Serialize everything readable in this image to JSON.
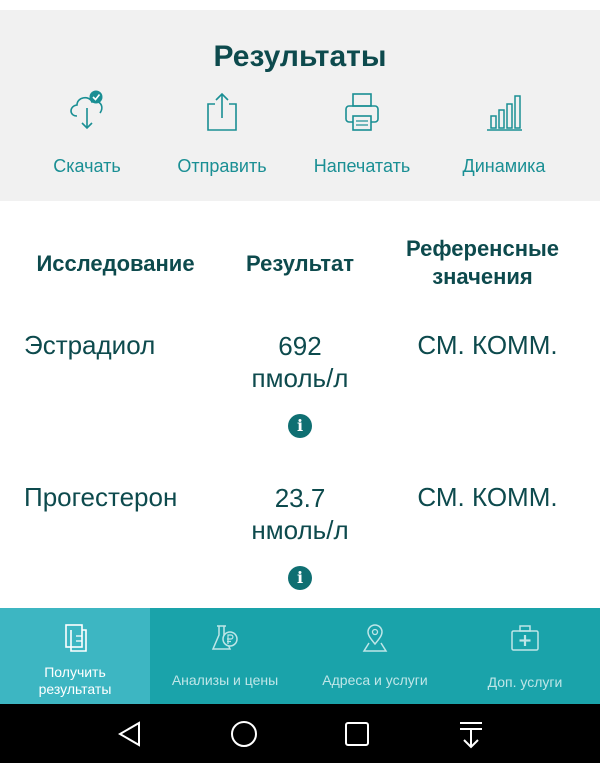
{
  "header": {
    "title": "Результаты",
    "actions": [
      {
        "label": "Скачать",
        "icon": "cloud-download-icon"
      },
      {
        "label": "Отправить",
        "icon": "share-icon"
      },
      {
        "label": "Напечатать",
        "icon": "printer-icon"
      },
      {
        "label": "Динамика",
        "icon": "bar-chart-icon"
      }
    ]
  },
  "table": {
    "headers": {
      "study": "Исследование",
      "result": "Результат",
      "reference_line1": "Референсные",
      "reference_line2": "значения"
    },
    "rows": [
      {
        "name": "Эстрадиол",
        "value": "692",
        "unit": "пмоль/л",
        "reference": "СМ. КОММ.",
        "info": "i"
      },
      {
        "name": "Прогестерон",
        "value": "23.7",
        "unit": "нмоль/л",
        "reference": "СМ. КОММ.",
        "info": "i"
      }
    ]
  },
  "tabbar": {
    "tabs": [
      {
        "line1": "Получить",
        "line2": "результаты",
        "icon": "documents-icon",
        "active": true
      },
      {
        "label": "Анализы и цены",
        "icon": "flask-ruble-icon",
        "active": false
      },
      {
        "label": "Адреса и услуги",
        "icon": "map-pin-icon",
        "active": false
      },
      {
        "label": "Доп. услуги",
        "icon": "first-aid-kit-icon",
        "active": false
      }
    ]
  },
  "colors": {
    "title": "#0d4a4d",
    "accent": "#1a8f94",
    "tabbar": "#1aa3aa",
    "tabbar_active": "#3db6c2",
    "header_bg": "#f1f1f1"
  }
}
